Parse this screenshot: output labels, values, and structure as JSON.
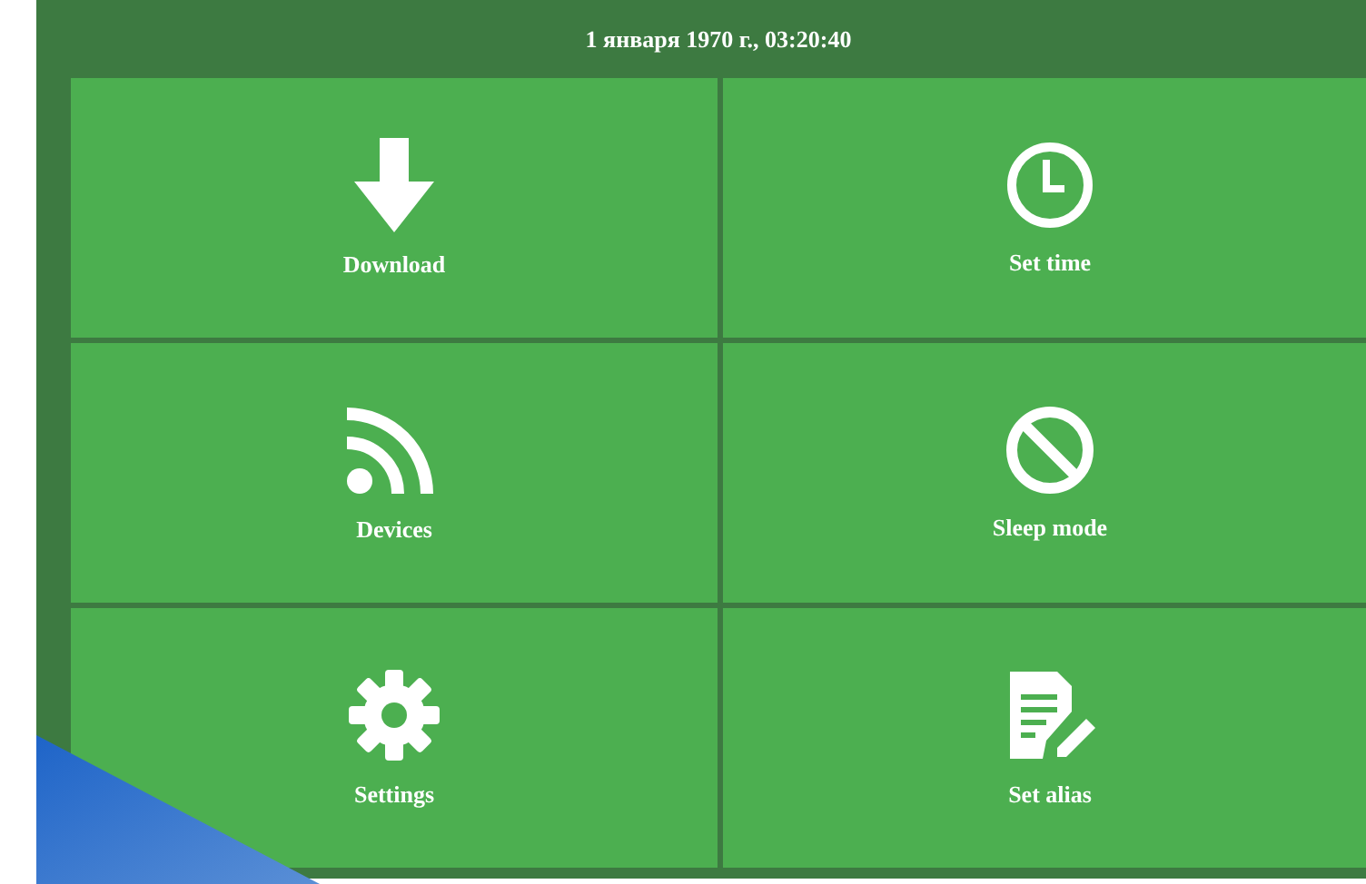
{
  "header": {
    "datetime": "1 января 1970 г., 03:20:40"
  },
  "tiles": [
    {
      "kind": "download",
      "label": "Download"
    },
    {
      "kind": "clock",
      "label": "Set time"
    },
    {
      "kind": "signal",
      "label": "Devices"
    },
    {
      "kind": "ban",
      "label": "Sleep mode"
    },
    {
      "kind": "gear",
      "label": "Settings"
    },
    {
      "kind": "note",
      "label": "Set alias"
    }
  ]
}
